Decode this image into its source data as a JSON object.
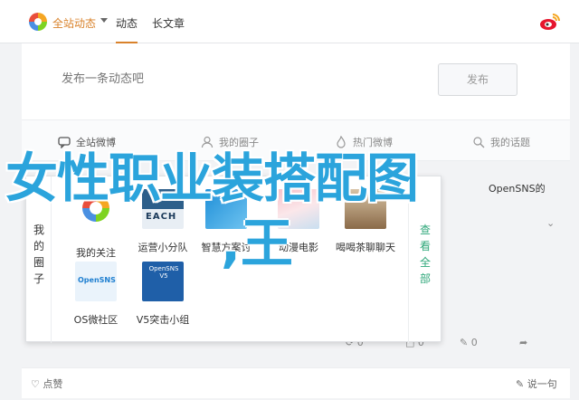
{
  "header": {
    "site_link": "全站动态",
    "tabs": [
      {
        "label": "动态"
      },
      {
        "label": "长文章"
      }
    ]
  },
  "composer": {
    "placeholder": "发布一条动态吧",
    "publish_label": "发布"
  },
  "share_bar": {
    "items": [
      {
        "label": "全站微博"
      },
      {
        "label": "我的圈子"
      },
      {
        "label": "热门微博"
      },
      {
        "label": "我的话题"
      }
    ]
  },
  "overlay": {
    "title": "女性职业装搭配图",
    "subtitle": ",王"
  },
  "panel": {
    "left_label": "我的圈子",
    "right_label": "查看全部",
    "side_tag": "OpenSNS的",
    "apps_row1": [
      {
        "name": "我的关注"
      },
      {
        "name": "运营小分队"
      },
      {
        "name": "智慧方案讨"
      },
      {
        "name": "动漫电影"
      },
      {
        "name": "喝喝茶聊聊天"
      }
    ],
    "apps_row2": [
      {
        "name": "OS微社区",
        "thumb_text": "OpenSNS"
      },
      {
        "name": "V5突击小组",
        "thumb_text": "OpenSNS V5"
      }
    ],
    "teach_text": "EACH"
  },
  "actions": {
    "a1": "0",
    "a2": "0",
    "a3": "0"
  },
  "footer": {
    "like": "点赞",
    "say": "说一句"
  },
  "colors": {
    "accent": "#d9822b",
    "overlay": "#2ba4dc",
    "green": "#2fa77a"
  }
}
